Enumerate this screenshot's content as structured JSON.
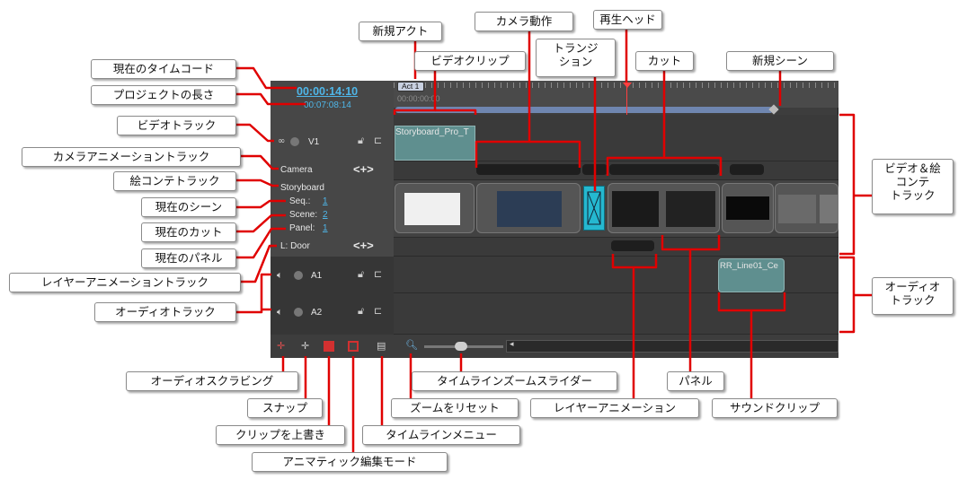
{
  "timeline": {
    "timecode": "00:00:14:10",
    "project_length": "00:07:08:14",
    "act_label": "Act 1",
    "ruler_time": "00:00:00:00",
    "v1_label": "V1",
    "camera_label": "Camera",
    "storyboard_label": "Storyboard",
    "seq_label": "Seq.:",
    "seq_value": "1",
    "scene_label": "Scene:",
    "scene_value": "2",
    "panel_label": "Panel:",
    "panel_value": "1",
    "layer_label": "L: Door",
    "a1_label": "A1",
    "a2_label": "A2",
    "video_clip_name": "Storyboard_Pro_T",
    "sound_clip_name": "RR_Line01_Ce",
    "camera_controls": "<+>",
    "layer_controls": "<+>"
  },
  "callouts": {
    "new_act": "新規アクト",
    "camera_motion": "カメラ動作",
    "playhead": "再生ヘッド",
    "transition": "トランジ\nション",
    "video_clip": "ビデオクリップ",
    "cut": "カット",
    "new_scene": "新規シーン",
    "current_timecode": "現在のタイムコード",
    "project_length": "プロジェクトの長さ",
    "video_track": "ビデオトラック",
    "camera_anim_track": "カメラアニメーショントラック",
    "storyboard_track": "絵コンテトラック",
    "current_scene": "現在のシーン",
    "current_cut": "現在のカット",
    "current_panel": "現在のパネル",
    "layer_anim_track": "レイヤーアニメーショントラック",
    "audio_track": "オーディオトラック",
    "video_storyboard_tracks": "ビデオ＆絵\nコンテ\nトラック",
    "audio_tracks": "オーディオ\nトラック",
    "audio_scrub": "オーディオスクラビング",
    "snap": "スナップ",
    "overwrite_clips": "クリップを上書き",
    "animatic_mode": "アニマティック編集モード",
    "timeline_menu": "タイムラインメニュー",
    "zoom_slider": "タイムラインズームスライダー",
    "reset_zoom": "ズームをリセット",
    "layer_animation": "レイヤーアニメーション",
    "panel": "パネル",
    "sound_clip": "サウンドクリップ"
  },
  "colors": {
    "accent_red": "#e00000",
    "clip_teal": "#5f8f8f",
    "transition_cyan": "#25b8d0",
    "timecode_blue": "#4fb6e8"
  }
}
